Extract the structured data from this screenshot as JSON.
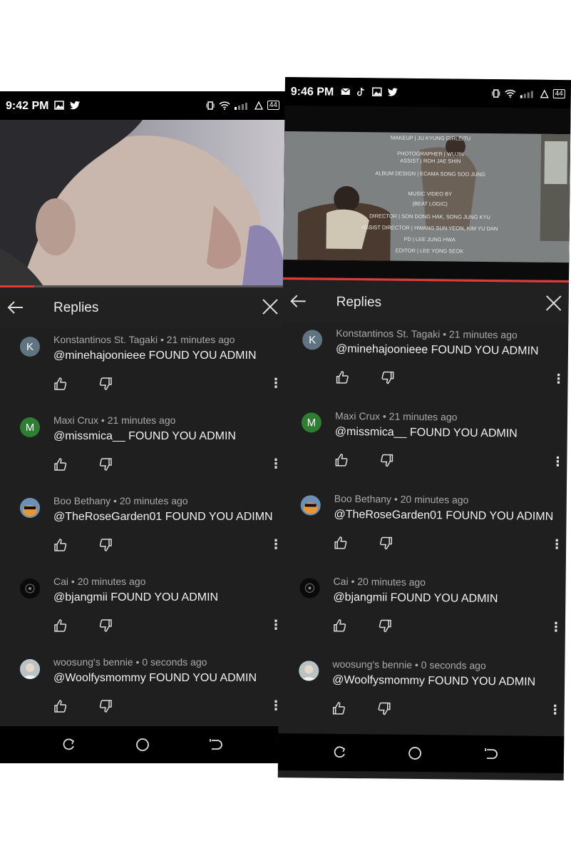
{
  "left": {
    "status": {
      "time": "9:42 PM",
      "battery": "44"
    },
    "video": {
      "progress": 0.12
    },
    "header": {
      "title": "Replies"
    },
    "comments": [
      {
        "avatar_letter": "K",
        "avatar_color": "#5f7381",
        "meta": "Konstantinos St. Tagaki • 21 minutes ago",
        "text": "@minehajoonieee FOUND YOU ADMIN"
      },
      {
        "avatar_letter": "M",
        "avatar_color": "#2e7d32",
        "meta": "Maxi Crux • 21 minutes ago",
        "text": "@missmica__ FOUND YOU ADMIN"
      },
      {
        "avatar_letter": "",
        "avatar_color": "#6b8fb5",
        "meta": "Boo Bethany • 20 minutes ago",
        "text": "@TheRoseGarden01 FOUND YOU ADIMN"
      },
      {
        "avatar_letter": "",
        "avatar_color": "#0a0a0a",
        "meta": "Cai • 20 minutes ago",
        "text": "@bjangmii FOUND YOU ADMIN"
      },
      {
        "avatar_letter": "",
        "avatar_color": "#b9c3c6",
        "meta": "woosung's bennie • 0 seconds ago",
        "text": "@Woolfysmommy FOUND YOU ADMIN"
      }
    ]
  },
  "right": {
    "status": {
      "time": "9:46 PM",
      "battery": "44"
    },
    "video": {
      "progress": 1.0,
      "credits": [
        "MAKEUP | JU KYUNG GIRLE/TU",
        "PHOTOGRAPHER | WUJIN",
        "ASSIST | ROH JAE SHIN",
        "ALBUM DESIGN | ECAMA SONG SOO JUNG",
        "MUSIC VIDEO BY",
        "(BEAT LOGIC)",
        "DIRECTOR | SON DONG HAK, SONG JUNG KYU",
        "ASSIST DIRECTOR | HWANG SUN YEON, KIM YU DAN",
        "PD | LEE JUNG HWA",
        "EDITOR | LEE YONG SEOK"
      ]
    },
    "header": {
      "title": "Replies"
    },
    "comments": [
      {
        "avatar_letter": "K",
        "avatar_color": "#5f7381",
        "meta": "Konstantinos St. Tagaki • 21 minutes ago",
        "text": "@minehajoonieee FOUND YOU ADMIN"
      },
      {
        "avatar_letter": "M",
        "avatar_color": "#2e7d32",
        "meta": "Maxi Crux • 21 minutes ago",
        "text": "@missmica__ FOUND YOU ADMIN"
      },
      {
        "avatar_letter": "",
        "avatar_color": "#6b8fb5",
        "meta": "Boo Bethany • 20 minutes ago",
        "text": "@TheRoseGarden01 FOUND YOU ADIMN"
      },
      {
        "avatar_letter": "",
        "avatar_color": "#0a0a0a",
        "meta": "Cai • 20 minutes ago",
        "text": "@bjangmii FOUND YOU ADMIN"
      },
      {
        "avatar_letter": "",
        "avatar_color": "#b9c3c6",
        "meta": "woosung's bennie • 0 seconds ago",
        "text": "@Woolfysmommy FOUND YOU ADMIN"
      }
    ]
  },
  "icons": {
    "back": "back-arrow-icon",
    "close": "close-icon",
    "like": "thumbs-up-icon",
    "dislike": "thumbs-down-icon",
    "more": "more-vertical-icon",
    "nav_recent": "recents-icon",
    "nav_home": "home-icon",
    "nav_back": "nav-back-icon"
  }
}
